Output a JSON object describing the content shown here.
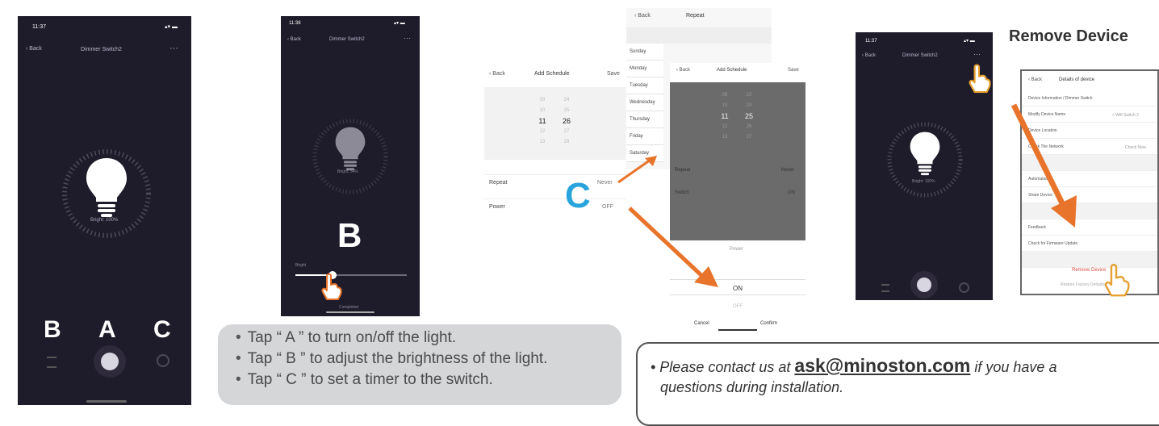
{
  "phone1": {
    "time": "11:37",
    "back": "Back",
    "title": "Dimmer Switch2",
    "more": "···",
    "bright": "Bright: 100%",
    "letters": {
      "b": "B",
      "a": "A",
      "c": "C"
    }
  },
  "phone2": {
    "time": "11:38",
    "back": "Back",
    "title": "Dimmer Switch2",
    "more": "···",
    "bright": "Bright: 34%",
    "letter": "B",
    "slider_label": "Bright",
    "slider_value": 0.33,
    "completed": "Completed"
  },
  "repeat_screen": {
    "back": "Back",
    "title": "Repeat",
    "days": [
      "Sunday",
      "Monday",
      "Tuesday",
      "Wednesday",
      "Thursday",
      "Friday",
      "Saturday"
    ]
  },
  "schedule1": {
    "back": "Back",
    "title": "Add Schedule",
    "save": "Save",
    "hours": [
      "09",
      "10",
      "11",
      "12",
      "13"
    ],
    "minutes": [
      "24",
      "25",
      "26",
      "27",
      "28"
    ],
    "repeat_label": "Repeat",
    "repeat_value": "Never",
    "power_label": "Power",
    "power_value": "OFF",
    "letter": "C"
  },
  "schedule2": {
    "back": "Back",
    "title": "Add Schedule",
    "save": "Save",
    "hours": [
      "09",
      "10",
      "11",
      "12",
      "13"
    ],
    "minutes": [
      "23",
      "24",
      "25",
      "26",
      "27"
    ],
    "repeat_label": "Repeat",
    "repeat_value": "Never",
    "power_label": "Switch",
    "power_value": "ON",
    "sheet_title": "Power",
    "option_on": "ON",
    "option_off": "OFF",
    "cancel": "Cancel",
    "confirm": "Confirm"
  },
  "phone3": {
    "time": "11:37",
    "back": "Back",
    "title": "Dimmer Switch2",
    "more": "···",
    "bright": "Bright: 100%"
  },
  "remove_device": {
    "heading": "Remove Device",
    "back": "Back",
    "title": "Details of device",
    "rows": [
      "Device Information / Dimmer Switch",
      "Modify Device Name",
      "Device Location",
      "Check The Network",
      "",
      "Automations",
      "Share Device",
      "",
      "Feedback",
      "Check for Firmware Update",
      ""
    ],
    "name_value": "> Wifi Switch 2",
    "network_value": "Check Now",
    "remove": "Remove Device",
    "restore": "Restore Factory Defaults"
  },
  "instructions": [
    "Tap “ A ” to turn on/off the light.",
    "Tap “ B ” to adjust the brightness of the light.",
    "Tap “ C ” to set a timer to the switch."
  ],
  "contact": {
    "prefix": "• Please contact us at ",
    "email": "ask@minoston.com",
    "suffix": " if you have a",
    "line2": "questions during installation."
  },
  "colors": {
    "accent": "#e8742b",
    "cyan": "#29a4dd",
    "phone_bg": "#1e1b2b"
  }
}
